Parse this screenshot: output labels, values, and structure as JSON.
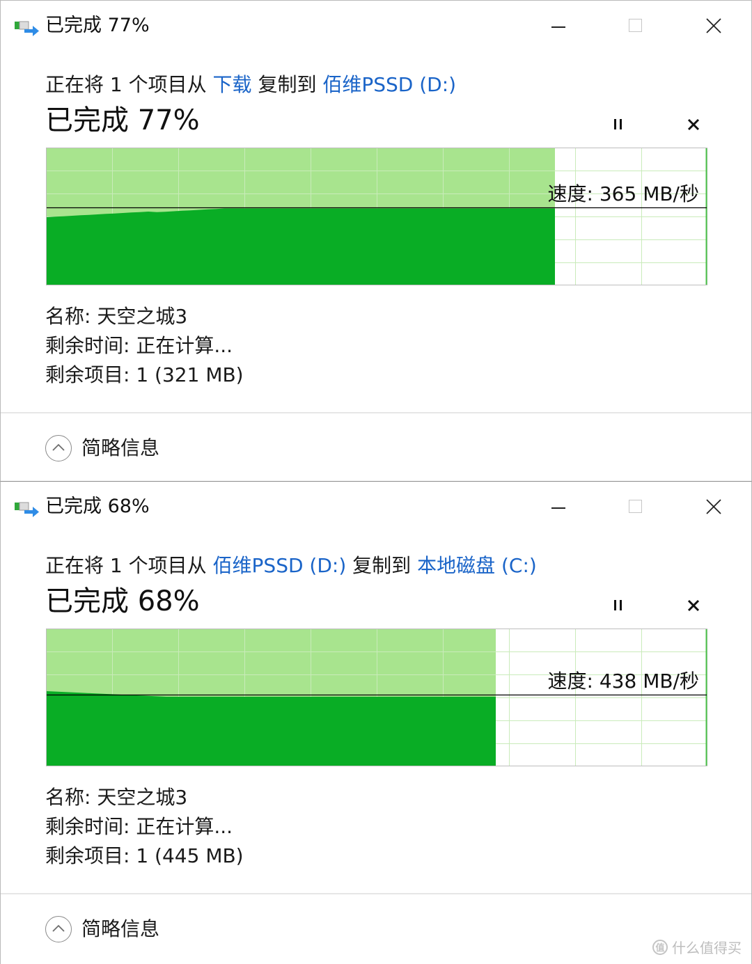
{
  "dialogs": [
    {
      "window_title": "已完成 77%",
      "copy_prefix": "正在将 1 个项目从 ",
      "source": "下载",
      "copy_mid": " 复制到 ",
      "destination": "佰维PSSD (D:)",
      "status": "已完成 77%",
      "progress_percent": 77,
      "speed_label": "速度: 365 MB/秒",
      "speed_value_mbps": 365,
      "name_line": "名称: 天空之城3",
      "time_line": "剩余时间: 正在计算...",
      "items_line": "剩余项目: 1 (321 MB)",
      "footer_label": "简略信息"
    },
    {
      "window_title": "已完成 68%",
      "copy_prefix": "正在将 1 个项目从 ",
      "source": "佰维PSSD (D:)",
      "copy_mid": " 复制到 ",
      "destination": "本地磁盘 (C:)",
      "status": "已完成 68%",
      "progress_percent": 68,
      "speed_label": "速度: 438 MB/秒",
      "speed_value_mbps": 438,
      "name_line": "名称: 天空之城3",
      "time_line": "剩余时间: 正在计算...",
      "items_line": "剩余项目: 1 (445 MB)",
      "footer_label": "简略信息"
    }
  ],
  "icons": {
    "app": "copy-transfer-icon",
    "minimize": "minimize-icon",
    "maximize": "maximize-icon",
    "close": "close-icon",
    "pause": "pause-icon",
    "cancel": "cancel-icon",
    "toggle": "chevron-up-icon"
  },
  "watermark": "值 什么值得买",
  "colors": {
    "link": "#1a64c8",
    "progress_fill": "#a8e48e",
    "speed_fill": "#09ad25",
    "grid": "#c9ebba",
    "speed_line": "#000000"
  }
}
